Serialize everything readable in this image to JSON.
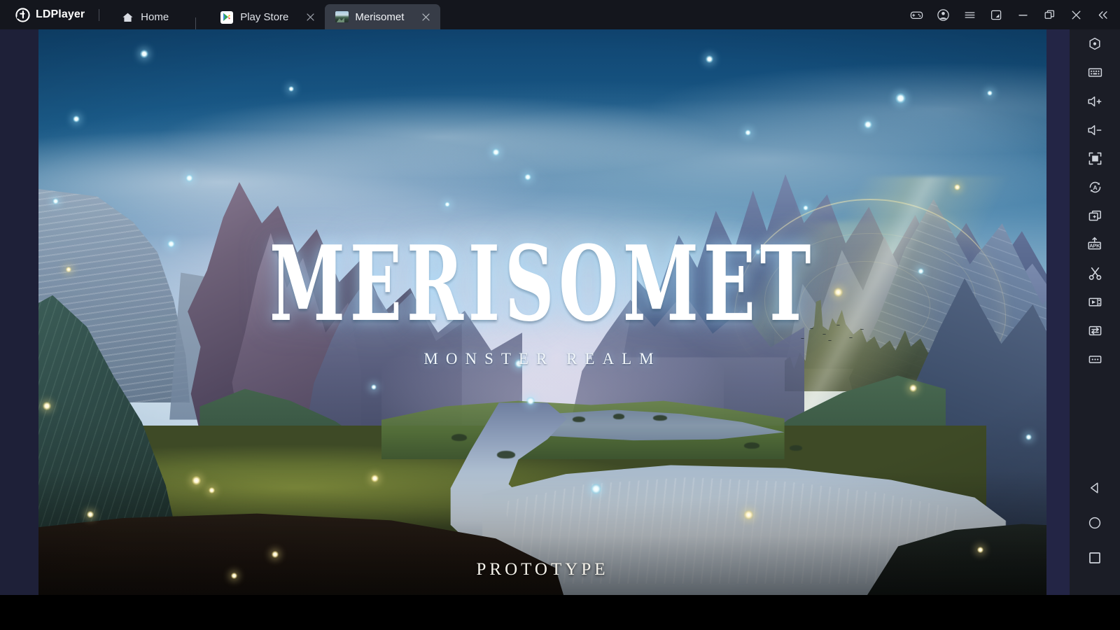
{
  "app": {
    "brand": "LDPlayer",
    "brand_logo_icon": "ldplayer-logo-icon"
  },
  "tabs": [
    {
      "id": "home",
      "label": "Home",
      "icon": "home-icon",
      "active": false,
      "closable": false
    },
    {
      "id": "playstore",
      "label": "Play Store",
      "icon": "play-store-icon",
      "active": false,
      "closable": true
    },
    {
      "id": "merisomet",
      "label": "Merisomet",
      "icon": "game-thumbnail-icon",
      "active": true,
      "closable": true
    }
  ],
  "window_controls": [
    {
      "id": "gamepad",
      "label": "Game Controls",
      "icon": "gamepad-icon"
    },
    {
      "id": "account",
      "label": "Account",
      "icon": "account-icon"
    },
    {
      "id": "menu",
      "label": "Menu",
      "icon": "hamburger-menu-icon"
    },
    {
      "id": "newwindow",
      "label": "New Window",
      "icon": "open-external-icon"
    },
    {
      "id": "minimize",
      "label": "Minimize",
      "icon": "minimize-icon"
    },
    {
      "id": "maximize",
      "label": "Maximize",
      "icon": "maximize-icon"
    },
    {
      "id": "close",
      "label": "Close",
      "icon": "close-icon"
    },
    {
      "id": "collapse",
      "label": "Collapse",
      "icon": "double-chevron-left-icon"
    }
  ],
  "toolbar": {
    "items": [
      {
        "id": "settings",
        "label": "Settings",
        "icon": "settings-hexagon-icon"
      },
      {
        "id": "keyboard",
        "label": "Keyboard Mapping",
        "icon": "keyboard-icon"
      },
      {
        "id": "volume-up",
        "label": "Volume Up",
        "icon": "volume-up-icon"
      },
      {
        "id": "volume-down",
        "label": "Volume Down",
        "icon": "volume-down-icon"
      },
      {
        "id": "fullscreen",
        "label": "Full Screen",
        "icon": "fullscreen-icon"
      },
      {
        "id": "auto-rotate",
        "label": "Rotate Screen",
        "icon": "auto-rotate-icon"
      },
      {
        "id": "multi-instance",
        "label": "Multi Instance",
        "icon": "multi-instance-icon"
      },
      {
        "id": "install-apk",
        "label": "Install APK",
        "icon": "apk-install-icon"
      },
      {
        "id": "screenshot",
        "label": "Screenshot",
        "icon": "scissors-icon"
      },
      {
        "id": "record",
        "label": "Screen Recorder",
        "icon": "video-record-icon"
      },
      {
        "id": "file-transfer",
        "label": "File Transfer",
        "icon": "file-transfer-icon"
      },
      {
        "id": "more",
        "label": "More",
        "icon": "ellipsis-icon"
      }
    ],
    "nav_items": [
      {
        "id": "back",
        "label": "Back",
        "icon": "back-triangle-icon"
      },
      {
        "id": "home",
        "label": "Home",
        "icon": "home-circle-icon"
      },
      {
        "id": "recents",
        "label": "Recents",
        "icon": "recents-square-icon"
      }
    ]
  },
  "game": {
    "title": "MERISOMET",
    "subtitle": "MONSTER REALM",
    "footer_label": "PROTOTYPE",
    "scene_description": "Fantasy valley splash screen with river, mountains, domed castle and glowing fireflies"
  },
  "colors": {
    "titlebar_bg": "#14161d",
    "active_tab_bg": "#373c47",
    "toolbar_bg": "#1b1d26",
    "frame_navy": "#1e2038",
    "text_primary": "#ffffff",
    "text_secondary": "#dfe2e8"
  }
}
